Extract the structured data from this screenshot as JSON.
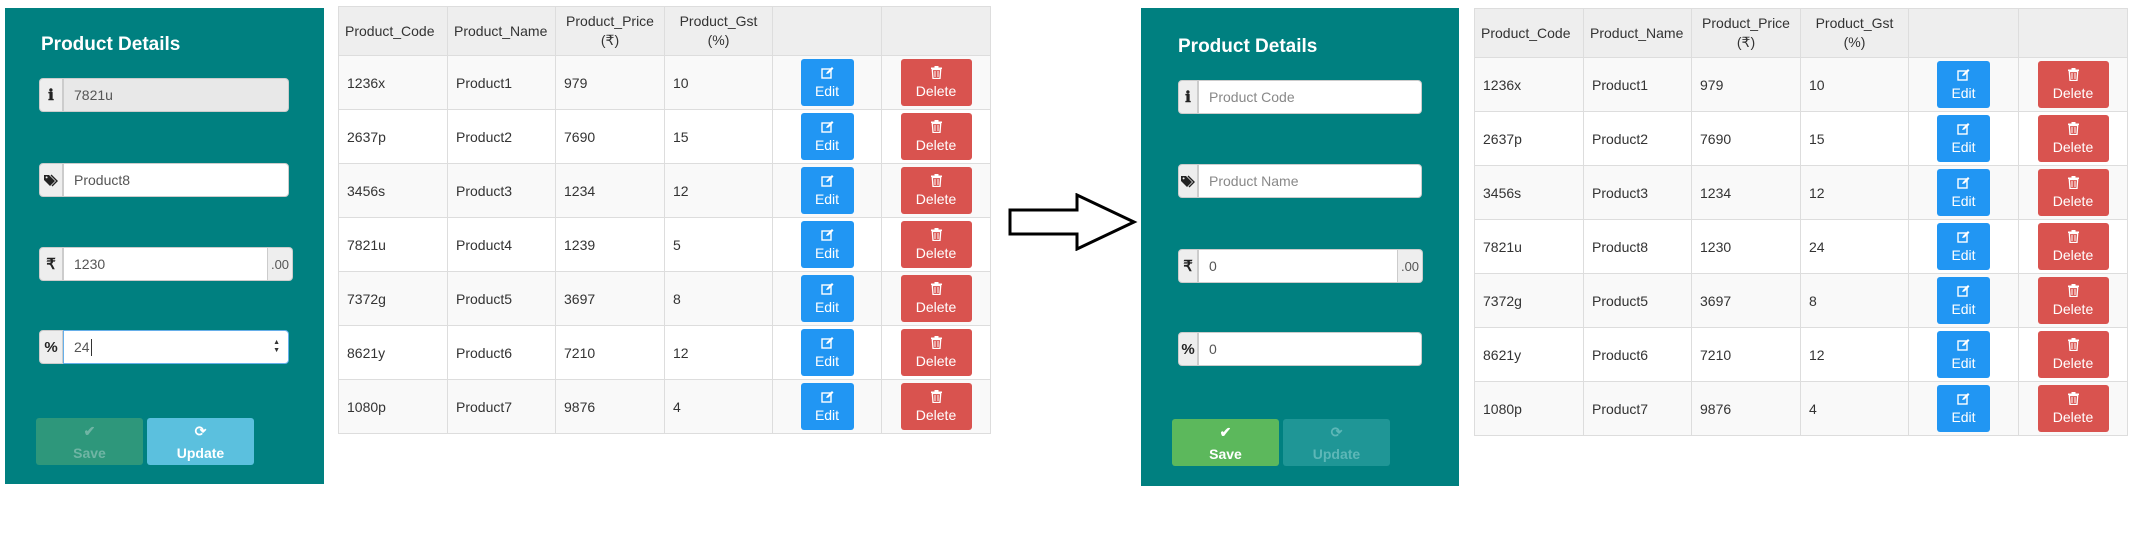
{
  "left": {
    "panel": {
      "title": "Product Details",
      "code_value": "7821u",
      "name_value": "Product8",
      "price_value": "1230",
      "price_suffix": ".00",
      "gst_value": "24",
      "save_label": "Save",
      "update_label": "Update"
    },
    "table": {
      "headers": [
        "Product_Code",
        "Product_Name",
        "Product_Price\n(₹)",
        "Product_Gst\n(%)"
      ],
      "rows": [
        [
          "1236x",
          "Product1",
          "979",
          "10"
        ],
        [
          "2637p",
          "Product2",
          "7690",
          "15"
        ],
        [
          "3456s",
          "Product3",
          "1234",
          "12"
        ],
        [
          "7821u",
          "Product4",
          "1239",
          "5"
        ],
        [
          "7372g",
          "Product5",
          "3697",
          "8"
        ],
        [
          "8621y",
          "Product6",
          "7210",
          "12"
        ],
        [
          "1080p",
          "Product7",
          "9876",
          "4"
        ]
      ],
      "edit_label": "Edit",
      "delete_label": "Delete"
    }
  },
  "right": {
    "panel": {
      "title": "Product Details",
      "code_placeholder": "Product Code",
      "name_placeholder": "Product Name",
      "price_value": "0",
      "price_suffix": ".00",
      "gst_value": "0",
      "save_label": "Save",
      "update_label": "Update"
    },
    "table": {
      "headers": [
        "Product_Code",
        "Product_Name",
        "Product_Price\n(₹)",
        "Product_Gst\n(%)"
      ],
      "rows": [
        [
          "1236x",
          "Product1",
          "979",
          "10"
        ],
        [
          "2637p",
          "Product2",
          "7690",
          "15"
        ],
        [
          "3456s",
          "Product3",
          "1234",
          "12"
        ],
        [
          "7821u",
          "Product8",
          "1230",
          "24"
        ],
        [
          "7372g",
          "Product5",
          "3697",
          "8"
        ],
        [
          "8621y",
          "Product6",
          "7210",
          "12"
        ],
        [
          "1080p",
          "Product7",
          "9876",
          "4"
        ]
      ],
      "edit_label": "Edit",
      "delete_label": "Delete"
    }
  },
  "icons": {
    "code_field": "info-icon",
    "name_field": "tags-icon",
    "price_field": "rupee-icon",
    "gst_field": "percent-icon",
    "save": "check-icon",
    "update": "refresh-icon",
    "edit": "edit-icon",
    "delete": "trash-icon",
    "transition": "right-arrow-icon"
  },
  "colors": {
    "panel": "#008080",
    "edit": "#2196f3",
    "delete": "#d9534f",
    "save_active": "#5cb85c",
    "update_active": "#5bc0de"
  }
}
